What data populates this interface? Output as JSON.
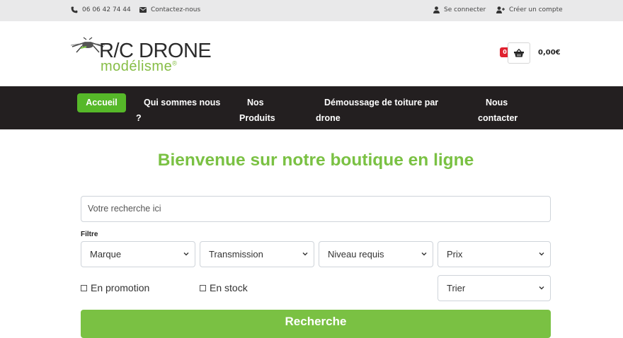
{
  "topbar": {
    "phone": "06 06 42 74 44",
    "contact": "Contactez-nous",
    "login": "Se connecter",
    "register": "Créer un compte"
  },
  "logo": {
    "brand": "R/C DRONE",
    "sub": "modélisme",
    "reg": "®"
  },
  "cart": {
    "count": "0",
    "total": "0,00€"
  },
  "nav": {
    "items": [
      {
        "line1": "Accueil",
        "line2": ""
      },
      {
        "line1": "Qui sommes nous",
        "line2": "?"
      },
      {
        "line1": "Nos",
        "line2": "Produits"
      },
      {
        "line1": "Démoussage de toiture par",
        "line2": "drone"
      },
      {
        "line1": "Nous",
        "line2": "contacter"
      }
    ]
  },
  "main": {
    "title": "Bienvenue sur notre boutique en ligne",
    "search_placeholder": "Votre recherche ici",
    "filter_label": "Filtre",
    "filters": [
      "Marque",
      "Transmission",
      "Niveau requis",
      "Prix"
    ],
    "checkbox_promo": "En promotion",
    "checkbox_stock": "En stock",
    "sort": "Trier",
    "submit": "Recherche"
  },
  "colors": {
    "brand_green": "#7ac143",
    "active_nav": "#56b829",
    "nav_bg": "#231f20",
    "badge_red": "#e0212f"
  }
}
